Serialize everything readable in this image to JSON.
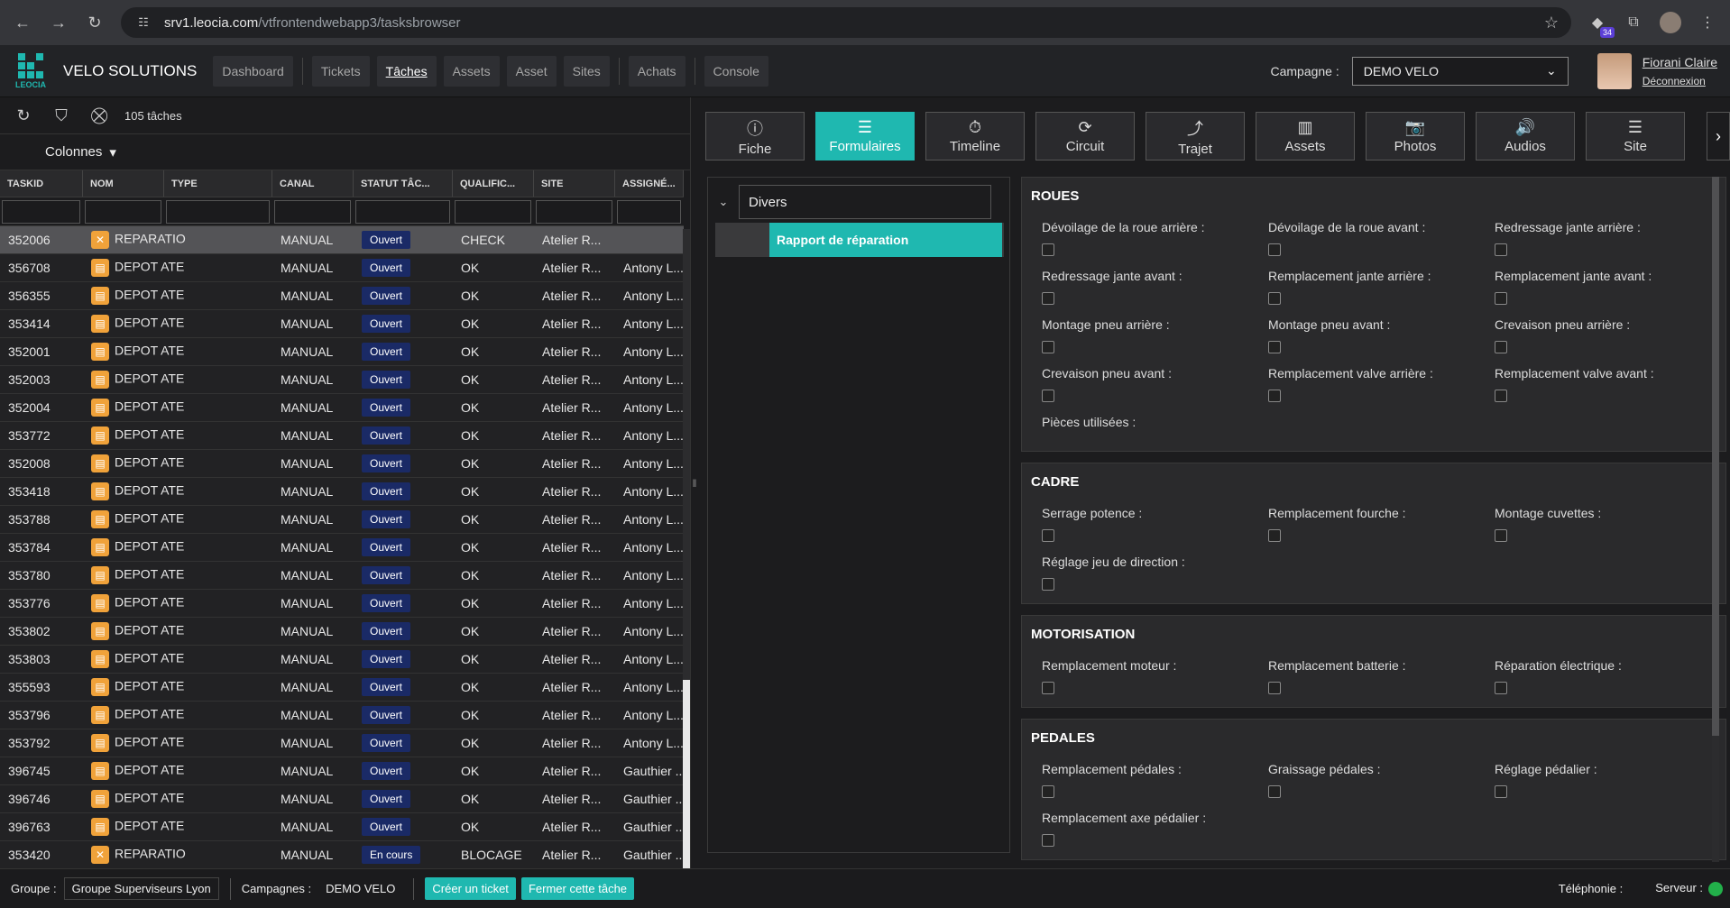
{
  "browser": {
    "url_host": "srv1.leocia.com",
    "url_path": "/vtfrontendwebapp3/tasksbrowser",
    "ext_badge": "34"
  },
  "app": {
    "logo_text": "LEOCIA",
    "brand": "VELO SOLUTIONS"
  },
  "menu": [
    "Dashboard",
    "Tickets",
    "Tâches",
    "Assets",
    "Asset",
    "Sites",
    "Achats",
    "Console"
  ],
  "campagne": {
    "label": "Campagne :",
    "value": "DEMO VELO"
  },
  "user": {
    "name": "Fiorani Claire",
    "logout": "Déconnexion"
  },
  "left": {
    "count": "105 tâches",
    "colonnes": "Colonnes",
    "headers": [
      "TASKID",
      "NOM",
      "TYPE",
      "CANAL",
      "STATUT TÂC...",
      "QUALIFIC...",
      "SITE",
      "ASSIGNÉ..."
    ],
    "rows": [
      {
        "id": "352006",
        "type": "REPARATIO",
        "canal": "MANUAL",
        "statut": "Ouvert",
        "qual": "CHECK",
        "site": "Atelier R...",
        "assign": ""
      },
      {
        "id": "356708",
        "type": "DEPOT ATE",
        "canal": "MANUAL",
        "statut": "Ouvert",
        "qual": "OK",
        "site": "Atelier R...",
        "assign": "Antony L..."
      },
      {
        "id": "356355",
        "type": "DEPOT ATE",
        "canal": "MANUAL",
        "statut": "Ouvert",
        "qual": "OK",
        "site": "Atelier R...",
        "assign": "Antony L..."
      },
      {
        "id": "353414",
        "type": "DEPOT ATE",
        "canal": "MANUAL",
        "statut": "Ouvert",
        "qual": "OK",
        "site": "Atelier R...",
        "assign": "Antony L..."
      },
      {
        "id": "352001",
        "type": "DEPOT ATE",
        "canal": "MANUAL",
        "statut": "Ouvert",
        "qual": "OK",
        "site": "Atelier R...",
        "assign": "Antony L..."
      },
      {
        "id": "352003",
        "type": "DEPOT ATE",
        "canal": "MANUAL",
        "statut": "Ouvert",
        "qual": "OK",
        "site": "Atelier R...",
        "assign": "Antony L..."
      },
      {
        "id": "352004",
        "type": "DEPOT ATE",
        "canal": "MANUAL",
        "statut": "Ouvert",
        "qual": "OK",
        "site": "Atelier R...",
        "assign": "Antony L..."
      },
      {
        "id": "353772",
        "type": "DEPOT ATE",
        "canal": "MANUAL",
        "statut": "Ouvert",
        "qual": "OK",
        "site": "Atelier R...",
        "assign": "Antony L..."
      },
      {
        "id": "352008",
        "type": "DEPOT ATE",
        "canal": "MANUAL",
        "statut": "Ouvert",
        "qual": "OK",
        "site": "Atelier R...",
        "assign": "Antony L..."
      },
      {
        "id": "353418",
        "type": "DEPOT ATE",
        "canal": "MANUAL",
        "statut": "Ouvert",
        "qual": "OK",
        "site": "Atelier R...",
        "assign": "Antony L..."
      },
      {
        "id": "353788",
        "type": "DEPOT ATE",
        "canal": "MANUAL",
        "statut": "Ouvert",
        "qual": "OK",
        "site": "Atelier R...",
        "assign": "Antony L..."
      },
      {
        "id": "353784",
        "type": "DEPOT ATE",
        "canal": "MANUAL",
        "statut": "Ouvert",
        "qual": "OK",
        "site": "Atelier R...",
        "assign": "Antony L..."
      },
      {
        "id": "353780",
        "type": "DEPOT ATE",
        "canal": "MANUAL",
        "statut": "Ouvert",
        "qual": "OK",
        "site": "Atelier R...",
        "assign": "Antony L..."
      },
      {
        "id": "353776",
        "type": "DEPOT ATE",
        "canal": "MANUAL",
        "statut": "Ouvert",
        "qual": "OK",
        "site": "Atelier R...",
        "assign": "Antony L..."
      },
      {
        "id": "353802",
        "type": "DEPOT ATE",
        "canal": "MANUAL",
        "statut": "Ouvert",
        "qual": "OK",
        "site": "Atelier R...",
        "assign": "Antony L..."
      },
      {
        "id": "353803",
        "type": "DEPOT ATE",
        "canal": "MANUAL",
        "statut": "Ouvert",
        "qual": "OK",
        "site": "Atelier R...",
        "assign": "Antony L..."
      },
      {
        "id": "355593",
        "type": "DEPOT ATE",
        "canal": "MANUAL",
        "statut": "Ouvert",
        "qual": "OK",
        "site": "Atelier R...",
        "assign": "Antony L..."
      },
      {
        "id": "353796",
        "type": "DEPOT ATE",
        "canal": "MANUAL",
        "statut": "Ouvert",
        "qual": "OK",
        "site": "Atelier R...",
        "assign": "Antony L..."
      },
      {
        "id": "353792",
        "type": "DEPOT ATE",
        "canal": "MANUAL",
        "statut": "Ouvert",
        "qual": "OK",
        "site": "Atelier R...",
        "assign": "Antony L..."
      },
      {
        "id": "396745",
        "type": "DEPOT ATE",
        "canal": "MANUAL",
        "statut": "Ouvert",
        "qual": "OK",
        "site": "Atelier R...",
        "assign": "Gauthier ..."
      },
      {
        "id": "396746",
        "type": "DEPOT ATE",
        "canal": "MANUAL",
        "statut": "Ouvert",
        "qual": "OK",
        "site": "Atelier R...",
        "assign": "Gauthier ..."
      },
      {
        "id": "396763",
        "type": "DEPOT ATE",
        "canal": "MANUAL",
        "statut": "Ouvert",
        "qual": "OK",
        "site": "Atelier R...",
        "assign": "Gauthier ..."
      },
      {
        "id": "353420",
        "type": "REPARATIO",
        "canal": "MANUAL",
        "statut": "En cours",
        "qual": "BLOCAGE",
        "site": "Atelier R...",
        "assign": "Gauthier ..."
      }
    ]
  },
  "tabs": [
    "Fiche",
    "Formulaires",
    "Timeline",
    "Circuit",
    "Trajet",
    "Assets",
    "Photos",
    "Audios",
    "Site"
  ],
  "tree": {
    "group": "Divers",
    "item": "Rapport de réparation"
  },
  "sections": [
    {
      "title": "ROUES",
      "fields": [
        "Dévoilage de la roue arrière :",
        "Dévoilage de la roue avant :",
        "Redressage jante arrière :",
        "Redressage jante avant :",
        "Remplacement jante arrière :",
        "Remplacement jante avant :",
        "Montage pneu arrière :",
        "Montage pneu avant :",
        "Crevaison pneu arrière :",
        "Crevaison pneu avant :",
        "Remplacement valve arrière :",
        "Remplacement valve avant :"
      ],
      "extra": "Pièces utilisées :"
    },
    {
      "title": "CADRE",
      "fields": [
        "Serrage potence :",
        "Remplacement fourche :",
        "Montage cuvettes :",
        "Réglage jeu de direction :"
      ],
      "extra": ""
    },
    {
      "title": "MOTORISATION",
      "fields": [
        "Remplacement moteur :",
        "Remplacement batterie :",
        "Réparation électrique :"
      ],
      "extra": ""
    },
    {
      "title": "PEDALES",
      "fields": [
        "Remplacement pédales :",
        "Graissage pédales :",
        "Réglage pédalier :",
        "Remplacement axe pédalier :"
      ],
      "extra": ""
    }
  ],
  "status": {
    "groupe_lbl": "Groupe :",
    "groupe": "Groupe Superviseurs Lyon",
    "campagnes_lbl": "Campagnes :",
    "campagnes": "DEMO VELO",
    "btn_ticket": "Créer un ticket",
    "btn_close": "Fermer cette tâche",
    "telephonie": "Téléphonie :",
    "serveur": "Serveur :"
  }
}
